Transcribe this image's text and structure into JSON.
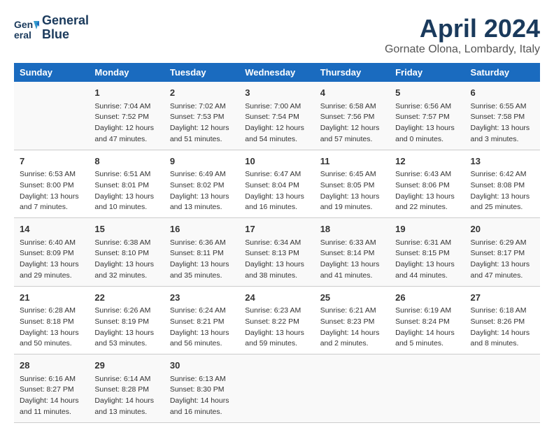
{
  "header": {
    "logo_line1": "General",
    "logo_line2": "Blue",
    "title": "April 2024",
    "subtitle": "Gornate Olona, Lombardy, Italy"
  },
  "weekdays": [
    "Sunday",
    "Monday",
    "Tuesday",
    "Wednesday",
    "Thursday",
    "Friday",
    "Saturday"
  ],
  "weeks": [
    [
      {
        "day": "",
        "info": ""
      },
      {
        "day": "1",
        "info": "Sunrise: 7:04 AM\nSunset: 7:52 PM\nDaylight: 12 hours\nand 47 minutes."
      },
      {
        "day": "2",
        "info": "Sunrise: 7:02 AM\nSunset: 7:53 PM\nDaylight: 12 hours\nand 51 minutes."
      },
      {
        "day": "3",
        "info": "Sunrise: 7:00 AM\nSunset: 7:54 PM\nDaylight: 12 hours\nand 54 minutes."
      },
      {
        "day": "4",
        "info": "Sunrise: 6:58 AM\nSunset: 7:56 PM\nDaylight: 12 hours\nand 57 minutes."
      },
      {
        "day": "5",
        "info": "Sunrise: 6:56 AM\nSunset: 7:57 PM\nDaylight: 13 hours\nand 0 minutes."
      },
      {
        "day": "6",
        "info": "Sunrise: 6:55 AM\nSunset: 7:58 PM\nDaylight: 13 hours\nand 3 minutes."
      }
    ],
    [
      {
        "day": "7",
        "info": "Sunrise: 6:53 AM\nSunset: 8:00 PM\nDaylight: 13 hours\nand 7 minutes."
      },
      {
        "day": "8",
        "info": "Sunrise: 6:51 AM\nSunset: 8:01 PM\nDaylight: 13 hours\nand 10 minutes."
      },
      {
        "day": "9",
        "info": "Sunrise: 6:49 AM\nSunset: 8:02 PM\nDaylight: 13 hours\nand 13 minutes."
      },
      {
        "day": "10",
        "info": "Sunrise: 6:47 AM\nSunset: 8:04 PM\nDaylight: 13 hours\nand 16 minutes."
      },
      {
        "day": "11",
        "info": "Sunrise: 6:45 AM\nSunset: 8:05 PM\nDaylight: 13 hours\nand 19 minutes."
      },
      {
        "day": "12",
        "info": "Sunrise: 6:43 AM\nSunset: 8:06 PM\nDaylight: 13 hours\nand 22 minutes."
      },
      {
        "day": "13",
        "info": "Sunrise: 6:42 AM\nSunset: 8:08 PM\nDaylight: 13 hours\nand 25 minutes."
      }
    ],
    [
      {
        "day": "14",
        "info": "Sunrise: 6:40 AM\nSunset: 8:09 PM\nDaylight: 13 hours\nand 29 minutes."
      },
      {
        "day": "15",
        "info": "Sunrise: 6:38 AM\nSunset: 8:10 PM\nDaylight: 13 hours\nand 32 minutes."
      },
      {
        "day": "16",
        "info": "Sunrise: 6:36 AM\nSunset: 8:11 PM\nDaylight: 13 hours\nand 35 minutes."
      },
      {
        "day": "17",
        "info": "Sunrise: 6:34 AM\nSunset: 8:13 PM\nDaylight: 13 hours\nand 38 minutes."
      },
      {
        "day": "18",
        "info": "Sunrise: 6:33 AM\nSunset: 8:14 PM\nDaylight: 13 hours\nand 41 minutes."
      },
      {
        "day": "19",
        "info": "Sunrise: 6:31 AM\nSunset: 8:15 PM\nDaylight: 13 hours\nand 44 minutes."
      },
      {
        "day": "20",
        "info": "Sunrise: 6:29 AM\nSunset: 8:17 PM\nDaylight: 13 hours\nand 47 minutes."
      }
    ],
    [
      {
        "day": "21",
        "info": "Sunrise: 6:28 AM\nSunset: 8:18 PM\nDaylight: 13 hours\nand 50 minutes."
      },
      {
        "day": "22",
        "info": "Sunrise: 6:26 AM\nSunset: 8:19 PM\nDaylight: 13 hours\nand 53 minutes."
      },
      {
        "day": "23",
        "info": "Sunrise: 6:24 AM\nSunset: 8:21 PM\nDaylight: 13 hours\nand 56 minutes."
      },
      {
        "day": "24",
        "info": "Sunrise: 6:23 AM\nSunset: 8:22 PM\nDaylight: 13 hours\nand 59 minutes."
      },
      {
        "day": "25",
        "info": "Sunrise: 6:21 AM\nSunset: 8:23 PM\nDaylight: 14 hours\nand 2 minutes."
      },
      {
        "day": "26",
        "info": "Sunrise: 6:19 AM\nSunset: 8:24 PM\nDaylight: 14 hours\nand 5 minutes."
      },
      {
        "day": "27",
        "info": "Sunrise: 6:18 AM\nSunset: 8:26 PM\nDaylight: 14 hours\nand 8 minutes."
      }
    ],
    [
      {
        "day": "28",
        "info": "Sunrise: 6:16 AM\nSunset: 8:27 PM\nDaylight: 14 hours\nand 11 minutes."
      },
      {
        "day": "29",
        "info": "Sunrise: 6:14 AM\nSunset: 8:28 PM\nDaylight: 14 hours\nand 13 minutes."
      },
      {
        "day": "30",
        "info": "Sunrise: 6:13 AM\nSunset: 8:30 PM\nDaylight: 14 hours\nand 16 minutes."
      },
      {
        "day": "",
        "info": ""
      },
      {
        "day": "",
        "info": ""
      },
      {
        "day": "",
        "info": ""
      },
      {
        "day": "",
        "info": ""
      }
    ]
  ]
}
